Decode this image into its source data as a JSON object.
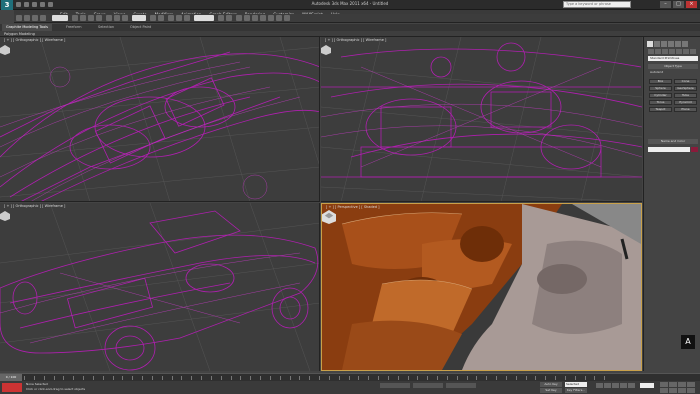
{
  "title_bar": {
    "logo": "3",
    "title": "Autodesk 3ds Max 2011 x64 - Untitled",
    "search_placeholder": "Type a keyword or phrase",
    "minimize": "–",
    "maximize": "□",
    "close": "×"
  },
  "menu": [
    "Edit",
    "Tools",
    "Group",
    "Views",
    "Create",
    "Modifiers",
    "Animation",
    "Graph Editors",
    "Rendering",
    "Customize",
    "MAXScript",
    "Help"
  ],
  "ribbon": {
    "tabs": [
      "Graphite Modeling Tools",
      "Freeform",
      "Selection",
      "Object Paint"
    ],
    "active_label": "Polygon Modeling"
  },
  "viewports": {
    "top_left_label": "[ + ] [ Orthographic ] [ Wireframe ]",
    "top_right_label": "[ + ] [ Orthographic ] [ Wireframe ]",
    "bottom_left_label": "[ + ] [ Orthographic ] [ Wireframe ]",
    "bottom_right_label": "[ + ] [ Perspective ] [ Shaded ]"
  },
  "command_panel": {
    "dropdown": "Standard Primitives",
    "rollout_object_type": "Object Type",
    "autogrid": "AutoGrid",
    "buttons": [
      "Box",
      "Cone",
      "Sphere",
      "GeoSphere",
      "Cylinder",
      "Tube",
      "Torus",
      "Pyramid",
      "Teapot",
      "Plane"
    ],
    "rollout_name_color": "Name and Color",
    "logo": "A"
  },
  "timeline": {
    "slider": "0 / 100",
    "tick_count": 60
  },
  "status": {
    "line1": "None Selected",
    "line2": "Click or click-and-drag to select objects",
    "auto_key": "Auto Key",
    "set_key": "Set Key",
    "selected": "Selected",
    "key_filters": "Key Filters..."
  },
  "colors": {
    "wire": "#b01fb0",
    "shaded": "#a8501a",
    "accent": "#c9a14a"
  }
}
